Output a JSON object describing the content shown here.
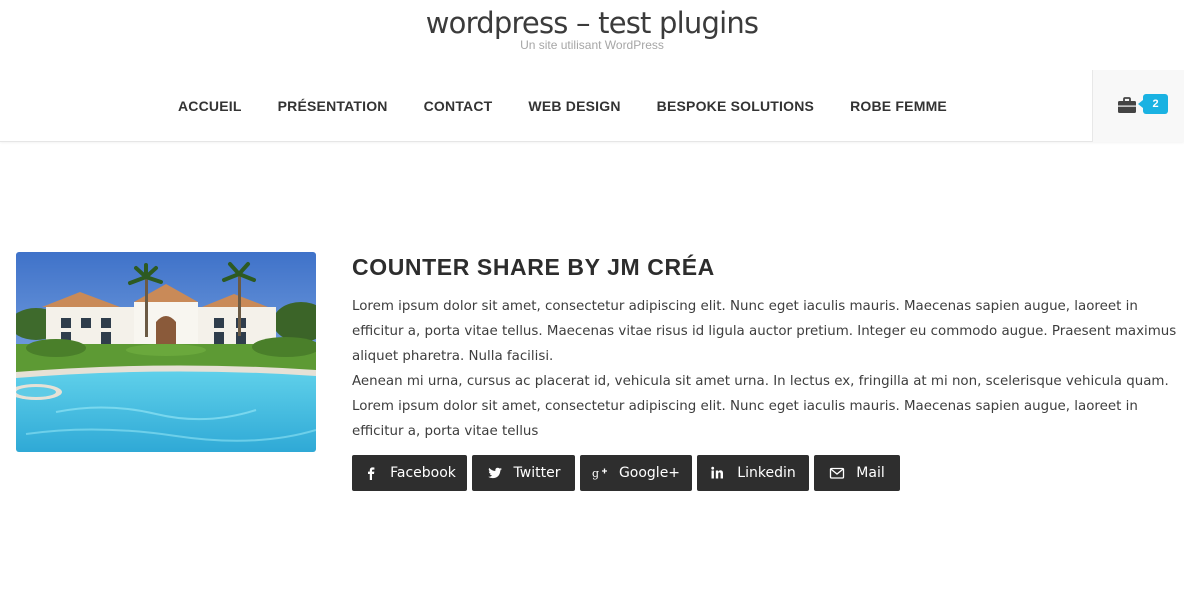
{
  "site": {
    "title": "wordpress – test plugins",
    "tagline": "Un site utilisant WordPress"
  },
  "nav": {
    "items": [
      {
        "label": "Accueil"
      },
      {
        "label": "Présentation"
      },
      {
        "label": "Contact"
      },
      {
        "label": "Web design"
      },
      {
        "label": "Bespoke solutions"
      },
      {
        "label": "Robe femme"
      }
    ]
  },
  "cart": {
    "icon": "shopping-bag-icon",
    "count": "2",
    "badge_color": "#1ab2e2"
  },
  "post": {
    "thumbnail": "villa-pool-image",
    "title": "Counter Share by JM Créa",
    "paragraphs": [
      "Lorem ipsum dolor sit amet, consectetur adipiscing elit. Nunc eget iaculis mauris. Maecenas sapien augue, laoreet in efficitur a, porta vitae tellus. Maecenas vitae risus id ligula auctor pretium. Integer eu commodo augue. Praesent maximus aliquet pharetra. Nulla facilisi.",
      "Aenean mi urna, cursus ac placerat id, vehicula sit amet urna. In lectus ex, fringilla at mi non, scelerisque vehicula quam. Lorem ipsum dolor sit amet, consectetur adipiscing elit. Nunc eget iaculis mauris. Maecenas sapien augue, laoreet in efficitur a, porta vitae tellus"
    ]
  },
  "share": {
    "button_color": "#2e2e2e",
    "buttons": [
      {
        "label": "Facebook",
        "icon": "facebook-icon"
      },
      {
        "label": "Twitter",
        "icon": "twitter-icon"
      },
      {
        "label": "Google+",
        "icon": "google-plus-icon"
      },
      {
        "label": "Linkedin",
        "icon": "linkedin-icon"
      },
      {
        "label": "Mail",
        "icon": "mail-icon"
      }
    ]
  }
}
